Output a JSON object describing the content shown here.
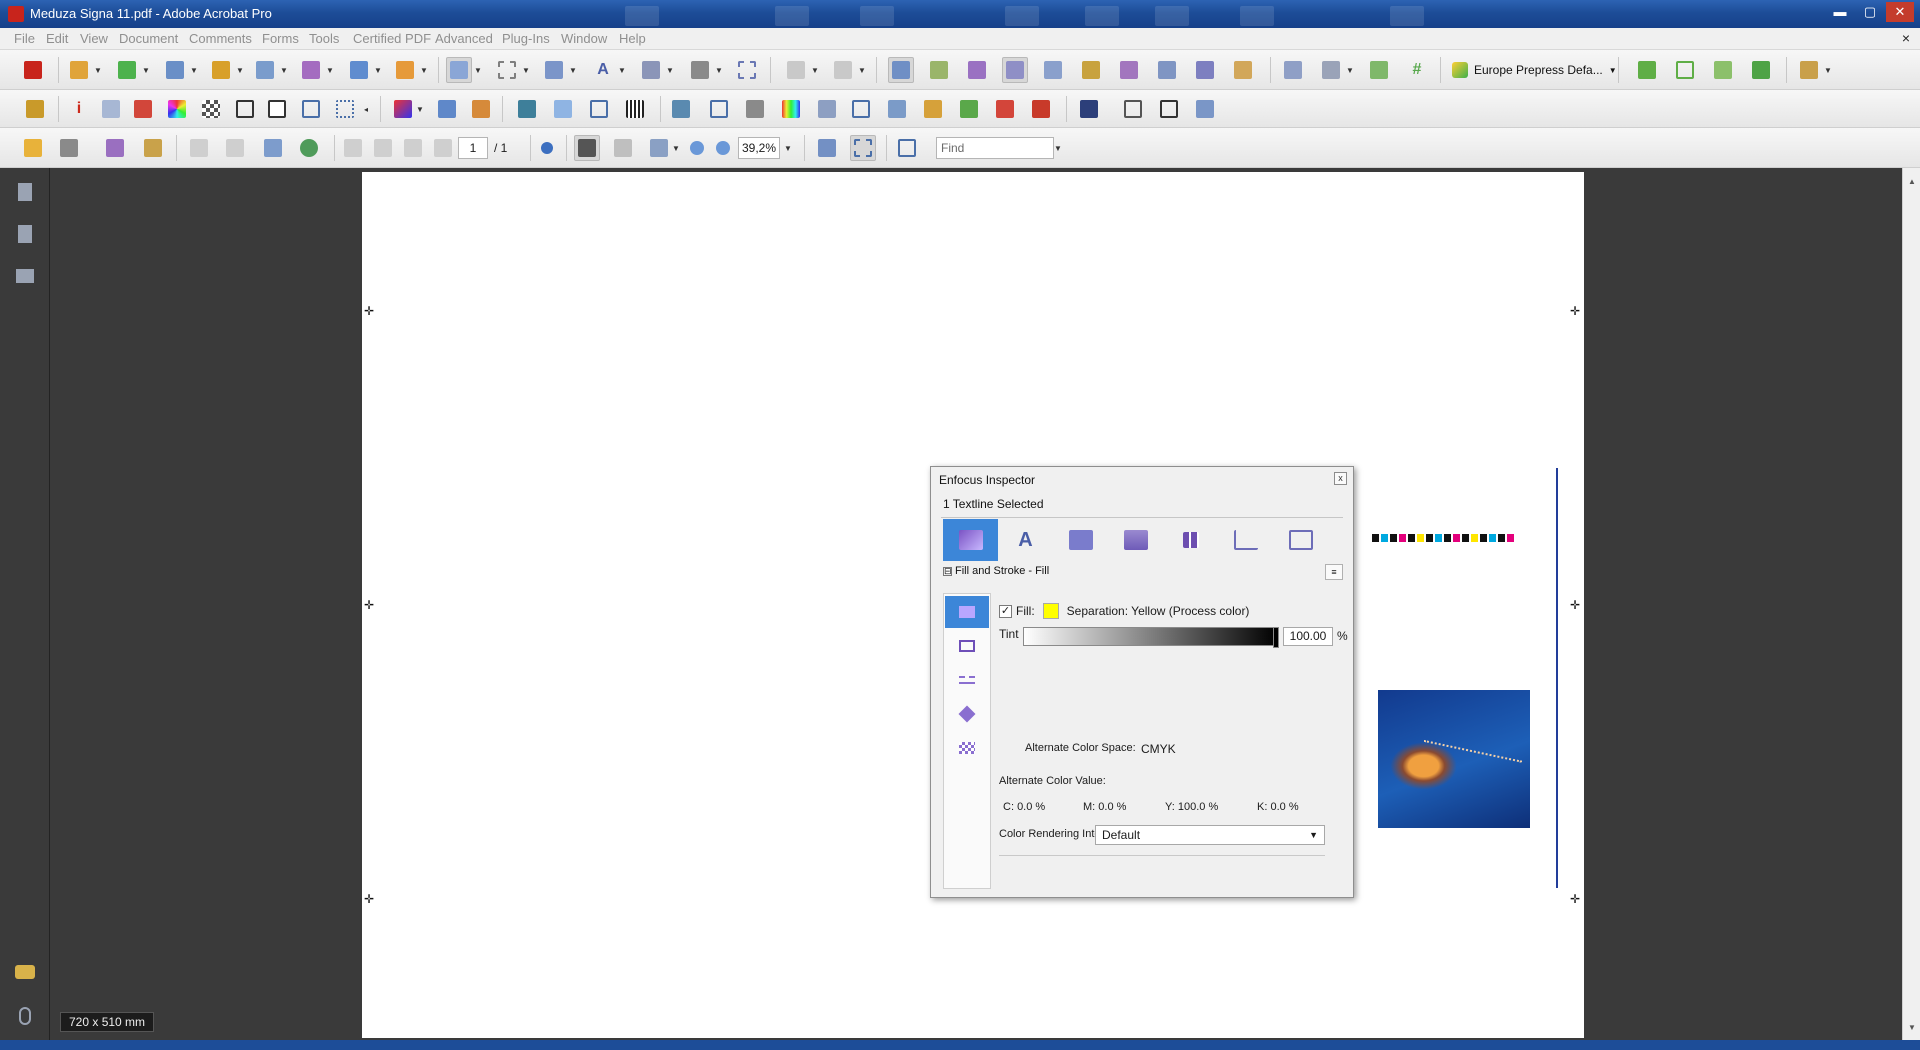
{
  "window": {
    "title": "Meduza Signa 11.pdf - Adobe Acrobat Pro",
    "minimize": "▬",
    "maximize": "▢",
    "close": "✕"
  },
  "menu": [
    "File",
    "Edit",
    "View",
    "Document",
    "Comments",
    "Forms",
    "Tools",
    "Certified PDF",
    "Advanced",
    "Plug-Ins",
    "Window",
    "Help"
  ],
  "menu_close": "×",
  "toolbar": {
    "preset_label": "Europe Prepress Defa...",
    "page_current": "1",
    "page_total": "/ 1",
    "zoom": "39,2%",
    "find_placeholder": "Find"
  },
  "document": {
    "dimensions": "720 x 510 mm"
  },
  "inspector": {
    "title": "Enfocus Inspector",
    "close": "x",
    "selection": "1 Textline Selected",
    "section_toggle": "⊟",
    "section": "Fill and Stroke - Fill",
    "section_menu": "≡",
    "fill_check": "✓",
    "fill_label": "Fill:",
    "fill_color": "#ffff00",
    "separation": "Separation: Yellow (Process color)",
    "tint_label": "Tint",
    "tint_fraction": 1.0,
    "tint_value": "100.00",
    "tint_unit": "%",
    "alt_space_label": "Alternate Color Space:",
    "alt_space_value": "CMYK",
    "alt_value_label": "Alternate Color Value:",
    "cmyk": [
      {
        "label": "C:",
        "value": "0.0 %"
      },
      {
        "label": "M:",
        "value": "0.0 %"
      },
      {
        "label": "Y:",
        "value": "100.0 %"
      },
      {
        "label": "K:",
        "value": "0.0 %"
      }
    ],
    "cri_label": "Color Rendering Intent:",
    "cri_value": "Default"
  }
}
